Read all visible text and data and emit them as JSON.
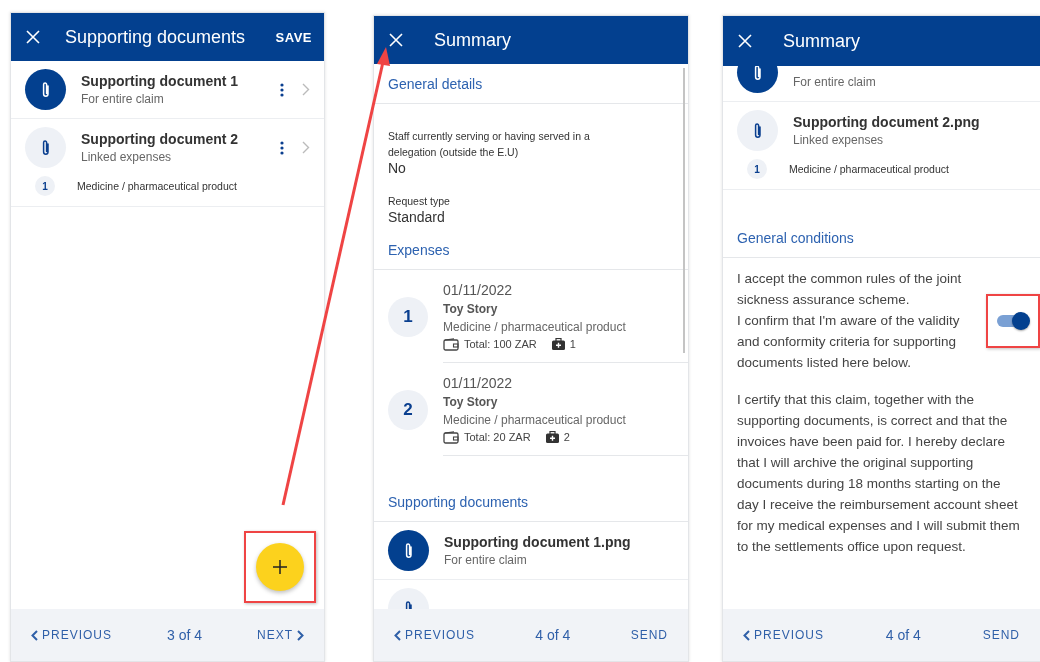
{
  "panels": [
    {
      "kind": "documents",
      "header": {
        "title": "Supporting documents",
        "action": "SAVE"
      },
      "sections": [
        {
          "kind": "documents",
          "documents": [
            {
              "kind": "entire",
              "name": "Supporting document 1",
              "scope": "For entire claim"
            },
            {
              "kind": "linked",
              "name": "Supporting document 2",
              "scope": "Linked expenses",
              "expenses": [
                {
                  "number": "1",
                  "label": "Medicine / pharmaceutical product"
                }
              ]
            }
          ]
        }
      ],
      "footer": {
        "previous": "PREVIOUS",
        "page": "3 of 4",
        "next": "NEXT"
      }
    },
    {
      "kind": "summary",
      "header": {
        "title": "Summary"
      },
      "sections": [
        {
          "kind": "details",
          "heading": "General details",
          "fields": [
            {
              "label": "Staff currently serving or having served in a delegation (outside the E.U)",
              "value": "No"
            },
            {
              "label": "Request type",
              "value": "Standard"
            }
          ]
        },
        {
          "kind": "expenses",
          "heading": "Expenses",
          "expenses": [
            {
              "number": "1",
              "date": "01/11/2022",
              "merchant": "Toy Story",
              "category": "Medicine / pharmaceutical product",
              "total": "Total: 100 ZAR",
              "documents": "1"
            },
            {
              "number": "2",
              "date": "01/11/2022",
              "merchant": "Toy Story",
              "category": "Medicine / pharmaceutical product",
              "total": "Total: 20 ZAR",
              "documents": "2"
            }
          ]
        },
        {
          "kind": "documents",
          "heading": "Supporting documents",
          "documents": [
            {
              "kind": "entire",
              "name": "Supporting document 1.png",
              "scope": "For entire claim"
            },
            {
              "kind": "linked"
            }
          ]
        }
      ],
      "footer": {
        "previous": "PREVIOUS",
        "page": "4 of 4",
        "next": "SEND"
      }
    },
    {
      "kind": "summary",
      "header": {
        "title": "Summary"
      },
      "sections": [
        {
          "kind": "documents",
          "documents": [
            {
              "kind": "entire",
              "scope": "For entire claim"
            },
            {
              "kind": "linked",
              "name": "Supporting document 2.png",
              "scope": "Linked expenses",
              "expenses": [
                {
                  "number": "1",
                  "label": "Medicine / pharmaceutical product"
                }
              ]
            }
          ]
        },
        {
          "kind": "conditions",
          "heading": "General conditions",
          "statements": [
            "I accept the common rules of the joint sickness assurance scheme.",
            "I confirm that I'm aware of the validity and conformity criteria for supporting documents listed here below."
          ],
          "accepted": true,
          "declaration": "I certify that this claim, together with the supporting documents, is correct and that the invoices have been paid for. I hereby declare that I will archive the original supporting documents during 18 months starting on the day I receive the reimbursement account sheet for my medical expenses and I will submit them to the settlements office upon request."
        }
      ],
      "footer": {
        "previous": "PREVIOUS",
        "page": "4 of 4",
        "next": "SEND"
      }
    }
  ]
}
